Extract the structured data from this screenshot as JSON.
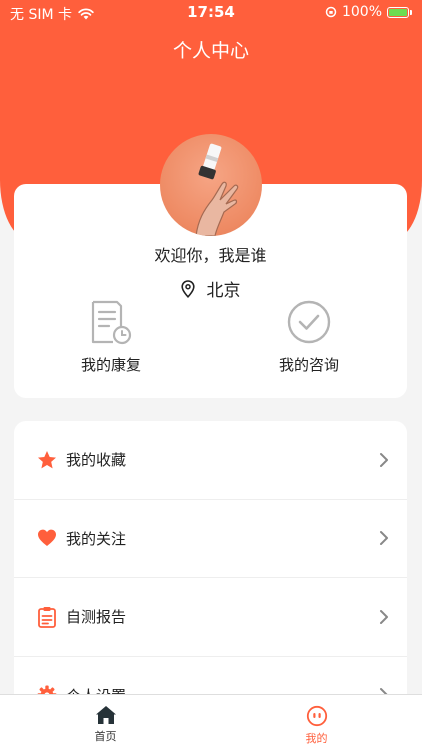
{
  "status_bar": {
    "carrier": "无 SIM 卡",
    "time": "17:54",
    "battery": "100%"
  },
  "header": {
    "title": "个人中心"
  },
  "profile": {
    "welcome": "欢迎你，我是谁",
    "location": "北京",
    "quick_actions": [
      {
        "label": "我的康复",
        "icon": "rehab-report-icon"
      },
      {
        "label": "我的咨询",
        "icon": "check-circle-icon"
      }
    ]
  },
  "menu": {
    "items": [
      {
        "label": "我的收藏",
        "icon": "star-icon"
      },
      {
        "label": "我的关注",
        "icon": "heart-icon"
      },
      {
        "label": "自测报告",
        "icon": "clipboard-icon"
      },
      {
        "label": "个人设置",
        "icon": "gear-icon"
      }
    ]
  },
  "tab_bar": {
    "tabs": [
      {
        "label": "首页",
        "icon": "home-icon",
        "active": false
      },
      {
        "label": "我的",
        "icon": "profile-face-icon",
        "active": true
      }
    ]
  },
  "colors": {
    "accent": "#ff5f3c",
    "icon_gray": "#b4b4b4",
    "text": "#222222",
    "active_tab": "#ff5f3c"
  }
}
